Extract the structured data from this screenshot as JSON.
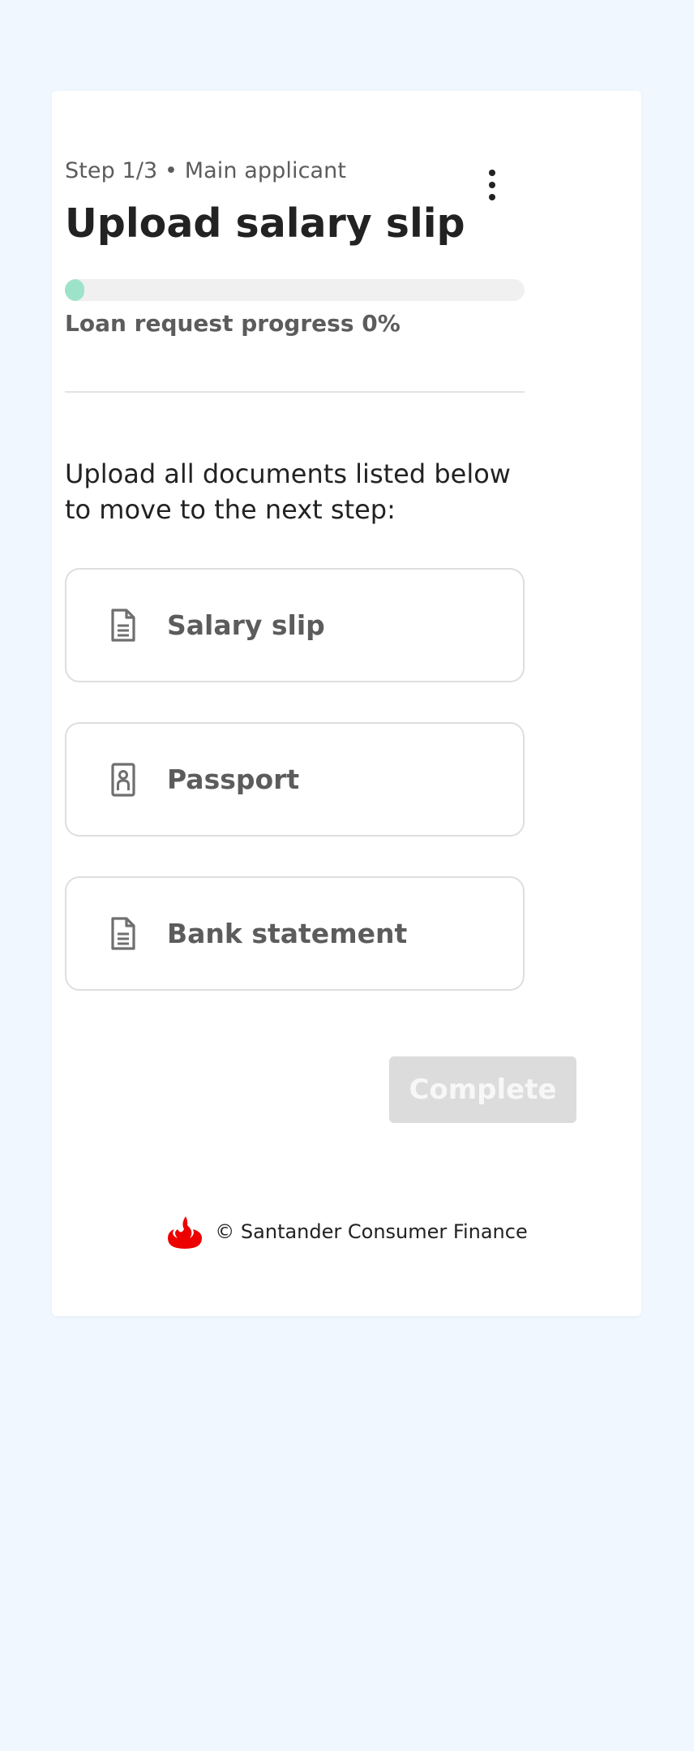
{
  "header": {
    "step_label": "Step 1/3 • Main applicant",
    "title": "Upload salary slip",
    "menu_icon": "more-vertical-icon"
  },
  "progress": {
    "label": "Loan request progress 0%",
    "value_percent": 0,
    "fill_color": "#9de3c9",
    "track_color": "#f0f0f0"
  },
  "instructions": "Upload all documents listed below to move to the next step:",
  "documents": [
    {
      "label": "Salary slip",
      "icon": "document-icon"
    },
    {
      "label": "Passport",
      "icon": "passport-icon"
    },
    {
      "label": "Bank statement",
      "icon": "document-icon"
    }
  ],
  "actions": {
    "complete_label": "Complete",
    "complete_disabled": true
  },
  "footer": {
    "brand_icon": "santander-flame-icon",
    "brand_color": "#ec0000",
    "text": "© Santander Consumer Finance"
  },
  "colors": {
    "page_background": "#f0f7fe",
    "card_background": "#ffffff",
    "button_disabled": "#dcdcdc"
  }
}
